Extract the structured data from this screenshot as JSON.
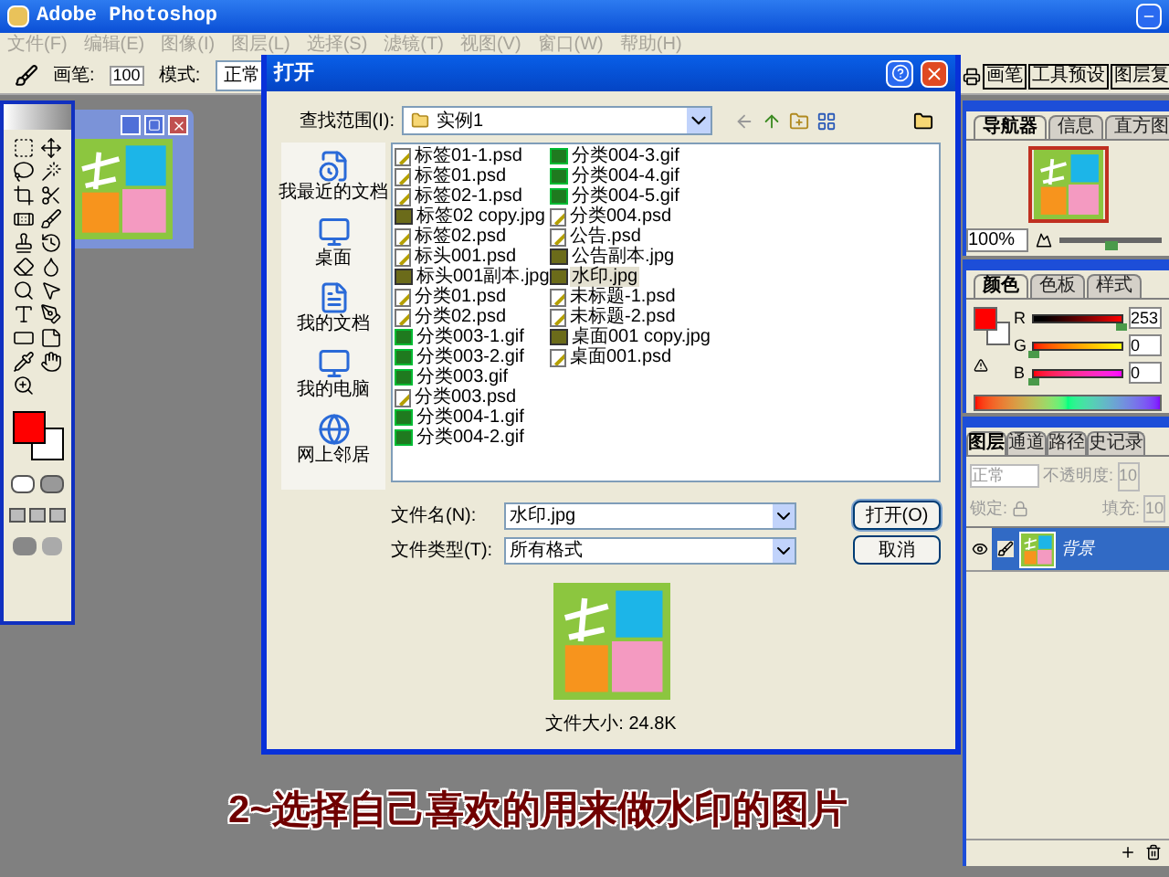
{
  "app": {
    "title": "Adobe Photoshop"
  },
  "menu": [
    {
      "label": "文件(F)",
      "disabled": true
    },
    {
      "label": "编辑(E)",
      "disabled": true
    },
    {
      "label": "图像(I)",
      "disabled": true
    },
    {
      "label": "图层(L)",
      "disabled": true
    },
    {
      "label": "选择(S)",
      "disabled": true
    },
    {
      "label": "滤镜(T)",
      "disabled": true
    },
    {
      "label": "视图(V)",
      "disabled": true
    },
    {
      "label": "窗口(W)",
      "disabled": true
    },
    {
      "label": "帮助(H)",
      "disabled": true
    }
  ],
  "options_bar": {
    "brush_label": "画笔:",
    "brush_size": "100",
    "mode_label": "模式:",
    "mode": "正常"
  },
  "palette_well": {
    "tabs": [
      "画笔",
      "工具预设",
      "图层复"
    ]
  },
  "dialog": {
    "title": "打开",
    "look_in_label": "查找范围(I):",
    "look_in": "实例1",
    "places": [
      "我最近的文档",
      "桌面",
      "我的文档",
      "我的电脑",
      "网上邻居"
    ],
    "files": [
      {
        "name": "标签01-1.psd",
        "kind": "psd",
        "selected": false
      },
      {
        "name": "标签01.psd",
        "kind": "psd",
        "selected": false
      },
      {
        "name": "标签02-1.psd",
        "kind": "psd",
        "selected": false
      },
      {
        "name": "标签02 copy.jpg",
        "kind": "jpg",
        "selected": false
      },
      {
        "name": "标签02.psd",
        "kind": "psd",
        "selected": false
      },
      {
        "name": "标头001.psd",
        "kind": "psd",
        "selected": false
      },
      {
        "name": "标头001副本.jpg",
        "kind": "jpg",
        "selected": false
      },
      {
        "name": "分类01.psd",
        "kind": "psd",
        "selected": false
      },
      {
        "name": "分类02.psd",
        "kind": "psd",
        "selected": false
      },
      {
        "name": "分类003-1.gif",
        "kind": "gif",
        "selected": false
      },
      {
        "name": "分类003-2.gif",
        "kind": "gif",
        "selected": false
      },
      {
        "name": "分类003.gif",
        "kind": "gif",
        "selected": false
      },
      {
        "name": "分类003.psd",
        "kind": "psd",
        "selected": false
      },
      {
        "name": "分类004-1.gif",
        "kind": "gif",
        "selected": false
      },
      {
        "name": "分类004-2.gif",
        "kind": "gif",
        "selected": false
      },
      {
        "name": "分类004-3.gif",
        "kind": "gif",
        "selected": false
      },
      {
        "name": "分类004-4.gif",
        "kind": "gif",
        "selected": false
      },
      {
        "name": "分类004-5.gif",
        "kind": "gif",
        "selected": false
      },
      {
        "name": "分类004.psd",
        "kind": "psd",
        "selected": false
      },
      {
        "name": "公告.psd",
        "kind": "psd",
        "selected": false
      },
      {
        "name": "公告副本.jpg",
        "kind": "jpg",
        "selected": false
      },
      {
        "name": "水印.jpg",
        "kind": "jpg",
        "selected": true
      },
      {
        "name": "未标题-1.psd",
        "kind": "psd",
        "selected": false
      },
      {
        "name": "未标题-2.psd",
        "kind": "psd",
        "selected": false
      },
      {
        "name": "桌面001 copy.jpg",
        "kind": "jpg",
        "selected": false
      },
      {
        "name": "桌面001.psd",
        "kind": "psd",
        "selected": false
      }
    ],
    "file_name_label": "文件名(N):",
    "file_name": "水印.jpg",
    "file_type_label": "文件类型(T):",
    "file_type": "所有格式",
    "buttons": [
      {
        "label": "打开(O)",
        "kind": "default"
      },
      {
        "label": "取消",
        "kind": "normal"
      }
    ],
    "preview_size": "文件大小: 24.8K"
  },
  "navigator": {
    "tabs": [
      {
        "label": "导航器",
        "selected": true
      },
      {
        "label": "信息",
        "selected": false
      },
      {
        "label": "直方图",
        "selected": false
      }
    ],
    "zoom": "100%",
    "level": 0.5
  },
  "color": {
    "tabs": [
      {
        "label": "颜色",
        "selected": true
      },
      {
        "label": "色板",
        "selected": false
      },
      {
        "label": "样式",
        "selected": false
      }
    ],
    "channels": [
      {
        "name": "R",
        "value": "253",
        "level": 0.99
      },
      {
        "name": "G",
        "value": "0",
        "level": 0
      },
      {
        "name": "B",
        "value": "0",
        "level": 0
      }
    ]
  },
  "layers": {
    "tabs": [
      {
        "label": "图层",
        "selected": true
      },
      {
        "label": "通道",
        "selected": false
      },
      {
        "label": "路径",
        "selected": false
      },
      {
        "label": "史记录",
        "selected": false
      }
    ],
    "blend_mode": "正常",
    "opacity_label": "不透明度:",
    "opacity": "10",
    "lock_label": "锁定:",
    "fill_label": "填充:",
    "fill": "10",
    "items": [
      {
        "name": "背景",
        "selected": true,
        "visible": true
      }
    ]
  },
  "caption": "2~选择自己喜欢的用来做水印的图片"
}
